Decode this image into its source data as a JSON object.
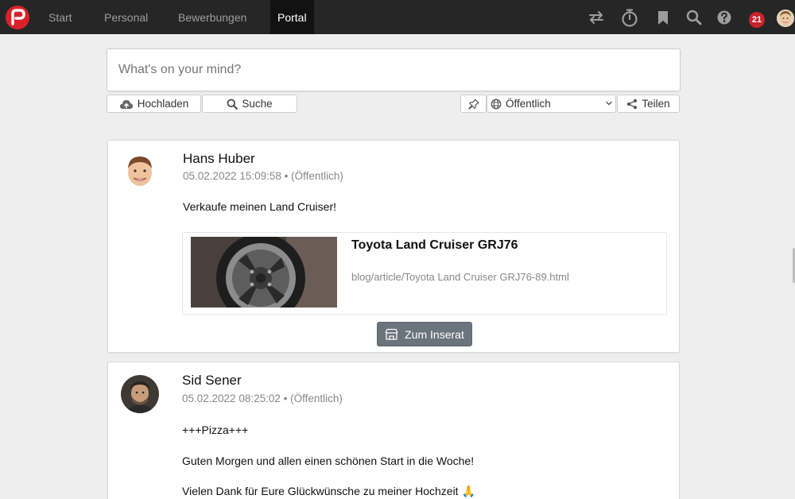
{
  "nav": {
    "items": [
      {
        "label": "Start",
        "active": false
      },
      {
        "label": "Personal",
        "active": false
      },
      {
        "label": "Bewerbungen",
        "active": false
      },
      {
        "label": "Portal",
        "active": true
      }
    ],
    "icons": [
      "exchange-icon",
      "stopwatch-icon",
      "bookmark-icon",
      "search-icon",
      "help-icon"
    ],
    "notification_count": "21"
  },
  "composer": {
    "placeholder": "What's on your mind?",
    "upload_label": "Hochladen",
    "search_label": "Suche",
    "visibility_selected": "Öffentlich",
    "share_label": "Teilen"
  },
  "posts": [
    {
      "author": "Hans Huber",
      "meta": "05.02.2022 15:09:58 • (Öffentlich)",
      "text": "Verkaufe meinen Land Cruiser!",
      "link": {
        "title": "Toyota Land Cruiser GRJ76",
        "url": "blog/article/Toyota Land Cruiser GRJ76-89.html"
      },
      "action_label": "Zum Inserat"
    },
    {
      "author": "Sid Sener",
      "meta": "05.02.2022 08:25:02 • (Öffentlich)",
      "paragraphs": [
        "+++Pizza+++",
        "Guten Morgen und allen einen schönen Start in die Woche!",
        "Vielen Dank für Eure Glückwünsche zu meiner Hochzeit 🙏"
      ]
    }
  ],
  "colors": {
    "topbar": "#262626",
    "brand_red": "#d8222a",
    "badge_red": "#c9232c",
    "action_button": "#6b737c",
    "page_background": "#eeeeee"
  }
}
